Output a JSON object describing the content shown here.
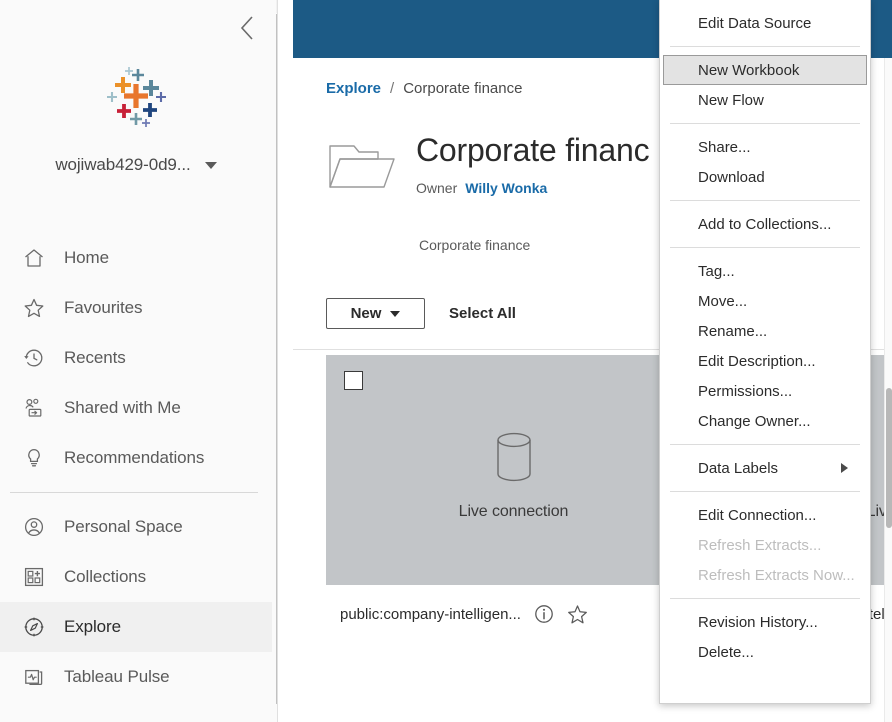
{
  "sidebar": {
    "collapse_icon": "chevron-left-icon",
    "logo": "tableau-logo",
    "site_name": "wojiwab429-0d9...",
    "site_caret_icon": "caret-down-icon",
    "items": [
      {
        "label": "Home",
        "icon": "home-icon",
        "active": false
      },
      {
        "label": "Favourites",
        "icon": "star-icon",
        "active": false
      },
      {
        "label": "Recents",
        "icon": "clock-back-icon",
        "active": false
      },
      {
        "label": "Shared with Me",
        "icon": "shared-users-icon",
        "active": false
      },
      {
        "label": "Recommendations",
        "icon": "lightbulb-icon",
        "active": false
      }
    ],
    "items2": [
      {
        "label": "Personal Space",
        "icon": "person-circle-icon",
        "active": false
      },
      {
        "label": "Collections",
        "icon": "collections-grid-icon",
        "active": false
      },
      {
        "label": "Explore",
        "icon": "compass-icon",
        "active": true
      },
      {
        "label": "Tableau Pulse",
        "icon": "pulse-stack-icon",
        "active": false
      }
    ]
  },
  "topbar": {
    "color": "#1c5a85"
  },
  "breadcrumb": {
    "root": "Explore",
    "separator": "/",
    "current": "Corporate finance"
  },
  "header": {
    "folder_icon": "folder-icon",
    "title": "Corporate financ",
    "owner_label": "Owner",
    "owner_name": "Willy Wonka",
    "description": "Corporate finance"
  },
  "toolbar": {
    "new_label": "New",
    "new_caret_icon": "caret-down-icon",
    "select_all_label": "Select All"
  },
  "cards": [
    {
      "checkbox_checked": false,
      "thumb_icon": "database-cylinder-icon",
      "connection": "Live connection",
      "name": "public:company-intelligen...",
      "info_icon": "info-circle-icon",
      "favourite_icon": "star-outline-icon"
    },
    {
      "checkbox_checked": false,
      "thumb_icon": "database-cylinder-icon",
      "connection": "Live connection",
      "name": "public:company-intel...",
      "info_icon": "info-circle-icon",
      "favourite_icon": "star-outline-icon"
    }
  ],
  "context_menu": {
    "groups": [
      {
        "items": [
          {
            "label": "Edit Data Source",
            "state": "normal"
          }
        ]
      },
      {
        "items": [
          {
            "label": "New Workbook",
            "state": "focused"
          },
          {
            "label": "New Flow",
            "state": "normal"
          }
        ]
      },
      {
        "items": [
          {
            "label": "Share...",
            "state": "normal"
          },
          {
            "label": "Download",
            "state": "normal"
          }
        ]
      },
      {
        "items": [
          {
            "label": "Add to Collections...",
            "state": "normal"
          }
        ]
      },
      {
        "items": [
          {
            "label": "Tag...",
            "state": "normal"
          },
          {
            "label": "Move...",
            "state": "normal"
          },
          {
            "label": "Rename...",
            "state": "normal"
          },
          {
            "label": "Edit Description...",
            "state": "normal"
          },
          {
            "label": "Permissions...",
            "state": "normal"
          },
          {
            "label": "Change Owner...",
            "state": "normal"
          }
        ]
      },
      {
        "items": [
          {
            "label": "Data Labels",
            "state": "submenu"
          }
        ]
      },
      {
        "items": [
          {
            "label": "Edit Connection...",
            "state": "normal"
          },
          {
            "label": "Refresh Extracts...",
            "state": "disabled"
          },
          {
            "label": "Refresh Extracts Now...",
            "state": "disabled"
          }
        ]
      },
      {
        "items": [
          {
            "label": "Revision History...",
            "state": "normal"
          },
          {
            "label": "Delete...",
            "state": "normal"
          }
        ]
      }
    ]
  },
  "colors": {
    "header_blue": "#1c5a85",
    "link_blue": "#1a6ba8",
    "sidebar_bg": "#fafafa",
    "card_thumb_bg": "#c2c5c8",
    "active_nav_bg": "#f0f0f0"
  }
}
